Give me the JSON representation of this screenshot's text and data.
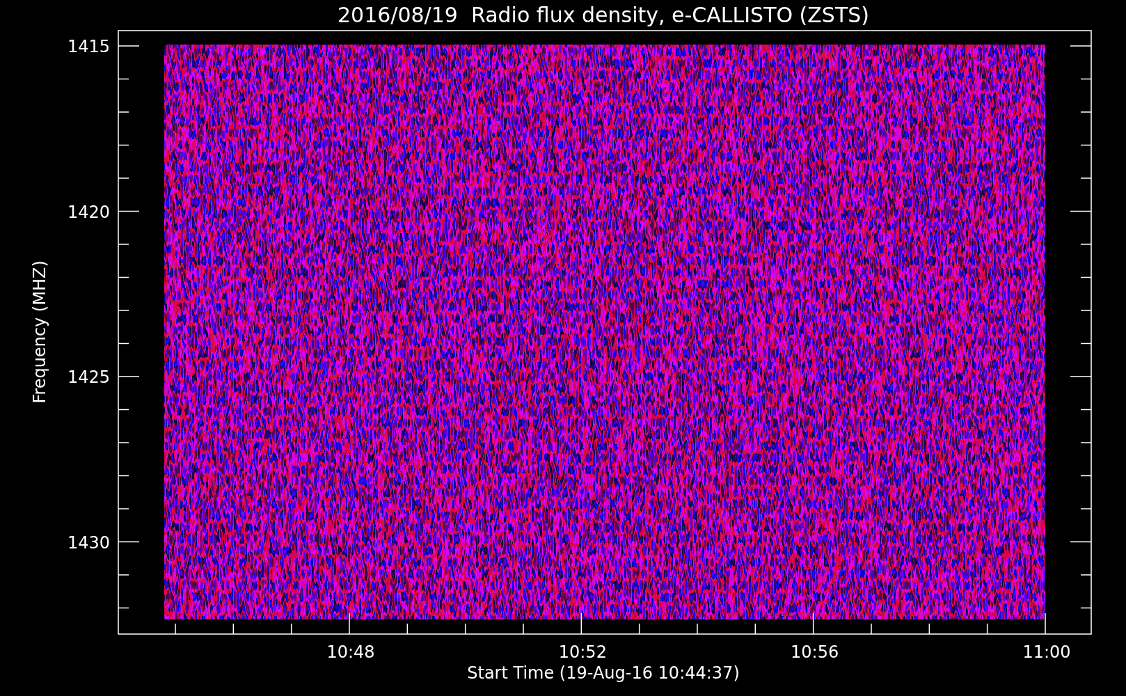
{
  "title": "2016/08/19  Radio flux density, e-CALLISTO (ZSTS)",
  "y_axis": {
    "label": "Frequency (MHZ)",
    "ticks": [
      "1415",
      "1420",
      "1425",
      "1430"
    ]
  },
  "x_axis": {
    "label": "Start Time (19-Aug-16 10:44:37)",
    "ticks": [
      "10:48",
      "10:52",
      "10:56",
      "11:00"
    ]
  }
}
